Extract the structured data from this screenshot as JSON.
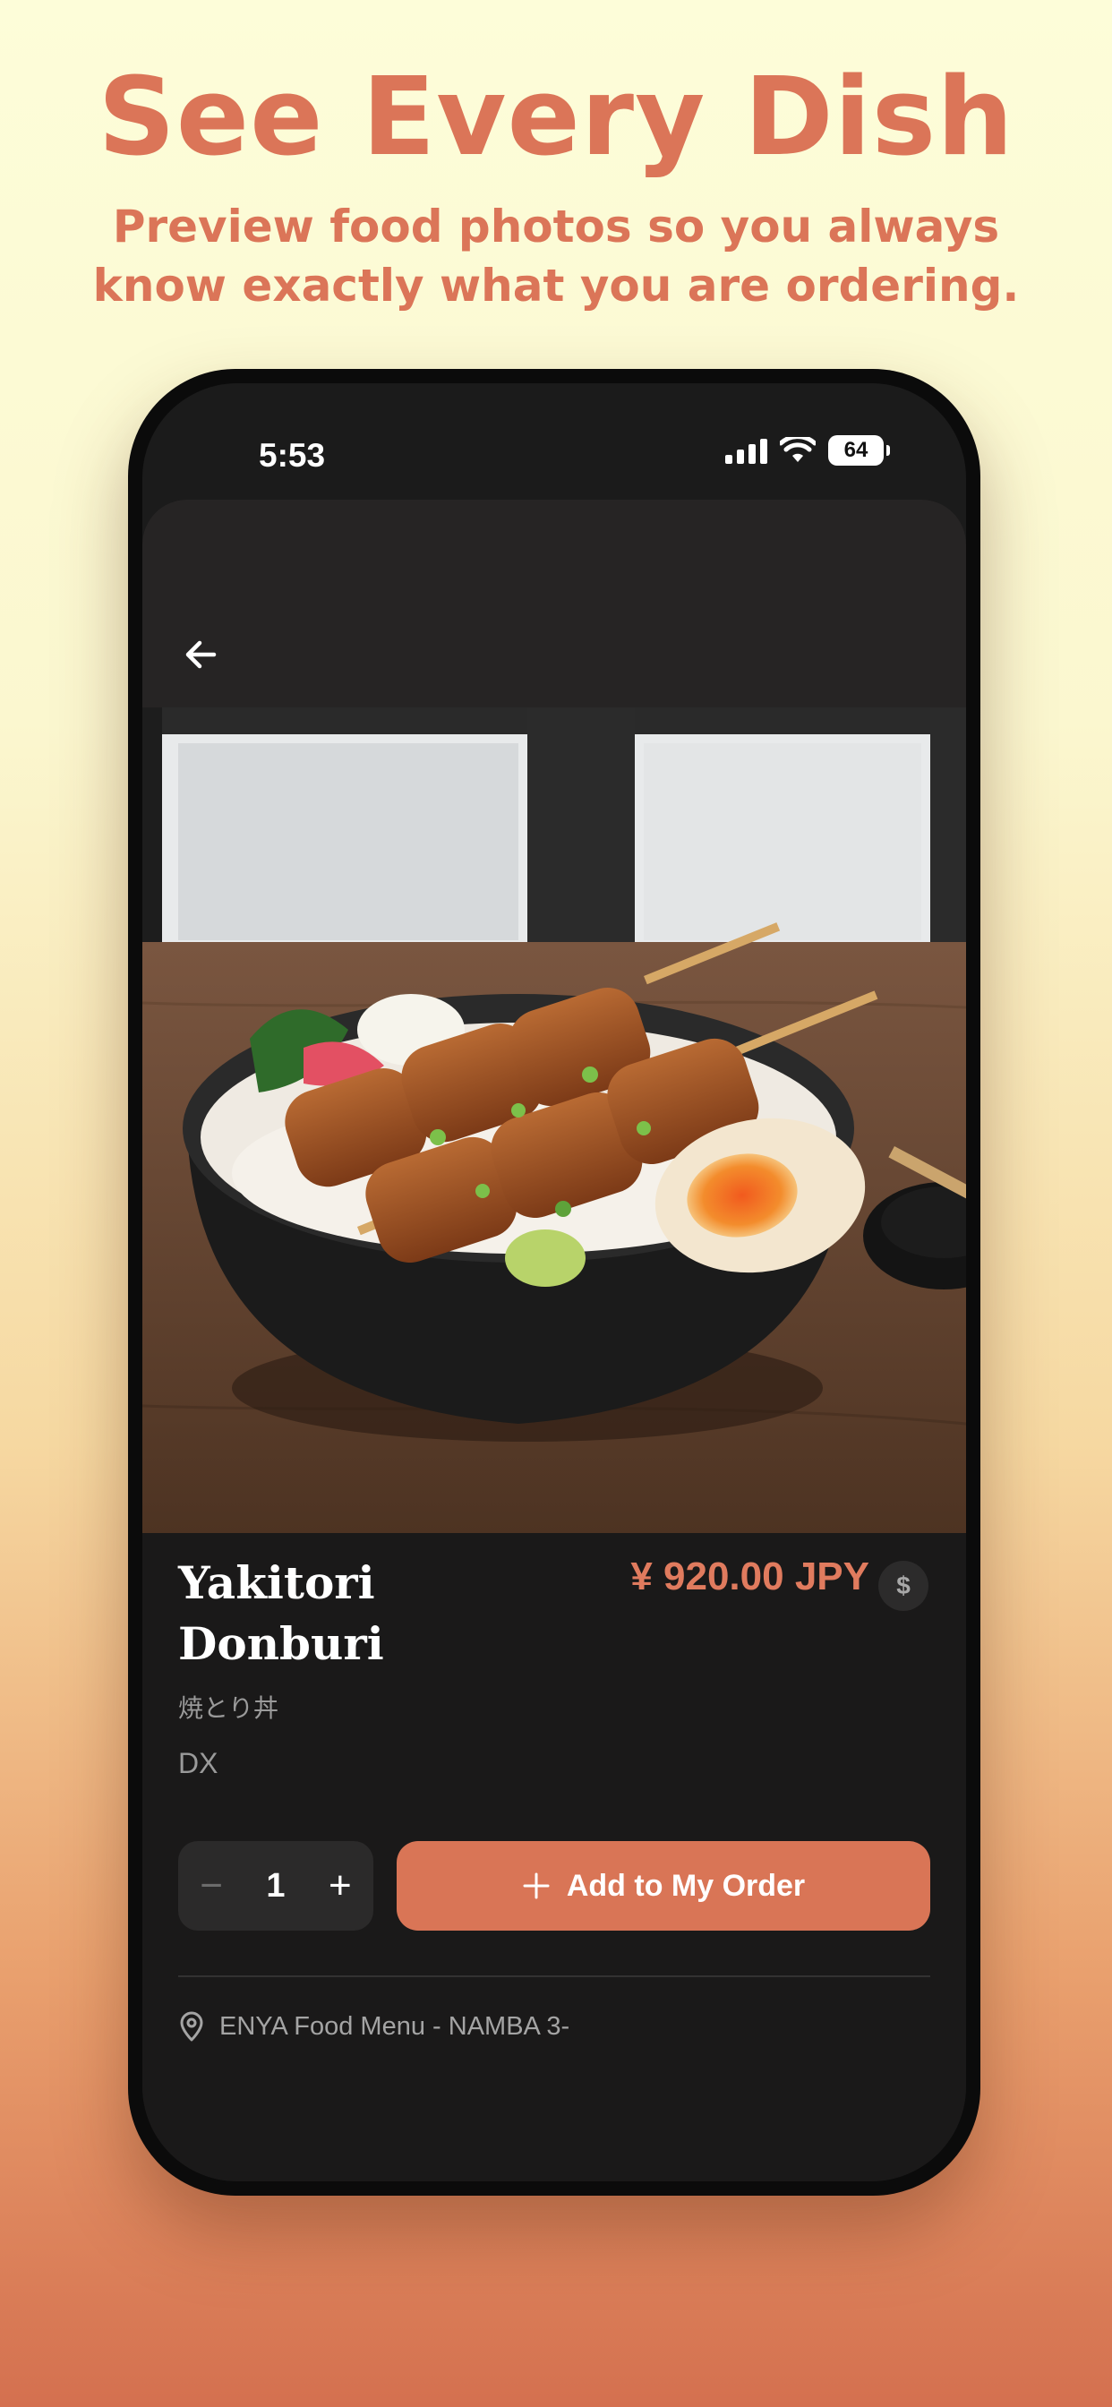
{
  "promo": {
    "headline": "See Every Dish",
    "subline": "Preview food photos so you always know exactly what you are ordering."
  },
  "status_bar": {
    "time": "5:53",
    "battery": "64",
    "icons": [
      "cellular-signal-icon",
      "wifi-icon",
      "battery-icon"
    ]
  },
  "header": {
    "back_icon": "arrow-left-icon"
  },
  "dish": {
    "photo_alt": "Yakitori Donburi",
    "name": "Yakitori Donburi",
    "name_jp": "焼とり丼",
    "variant": "DX",
    "price": "¥ 920.00 JPY",
    "currency_button": "$"
  },
  "order": {
    "minus": "−",
    "quantity": "1",
    "plus": "+",
    "add_icon": "+",
    "add_label": "Add to My Order"
  },
  "location": {
    "icon": "location-pin-icon",
    "text": "ENYA Food Menu - NAMBA 3-"
  },
  "colors": {
    "accent": "#d97556",
    "price": "#e07b5e",
    "background_dark": "#1a1919"
  }
}
